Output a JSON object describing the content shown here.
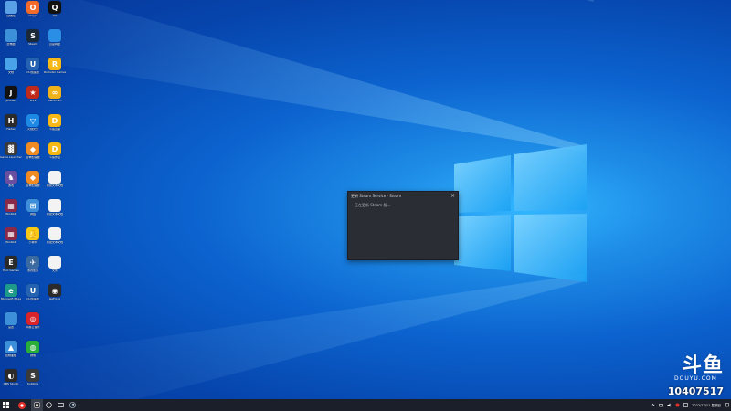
{
  "desktop_icons": [
    {
      "col": 0,
      "row": 0,
      "label": "回收站",
      "color": "#5aa0e6",
      "icon": "recycle-bin-icon",
      "glyph": ""
    },
    {
      "col": 1,
      "row": 0,
      "label": "Origin",
      "color": "#f26b2a",
      "icon": "origin-icon",
      "glyph": "O"
    },
    {
      "col": 2,
      "row": 0,
      "label": "QQ",
      "color": "#111111",
      "icon": "qq-icon",
      "glyph": "Q"
    },
    {
      "col": 0,
      "row": 1,
      "label": "此电脑",
      "color": "#3d8fd9",
      "icon": "this-pc-icon",
      "glyph": ""
    },
    {
      "col": 1,
      "row": 1,
      "label": "Steam",
      "color": "#1b2838",
      "icon": "steam-icon",
      "glyph": "S"
    },
    {
      "col": 2,
      "row": 1,
      "label": "百度网盘",
      "color": "#2a8ee6",
      "icon": "baidu-netdisk-icon",
      "glyph": ""
    },
    {
      "col": 0,
      "row": 2,
      "label": "文档",
      "color": "#4aa3e8",
      "icon": "documents-icon",
      "glyph": ""
    },
    {
      "col": 1,
      "row": 2,
      "label": "UU加速器",
      "color": "#2563b0",
      "icon": "uu-accelerator-icon",
      "glyph": "U"
    },
    {
      "col": 2,
      "row": 2,
      "label": "Rockstar Games",
      "color": "#f5b816",
      "icon": "rockstar-icon",
      "glyph": "R"
    },
    {
      "col": 0,
      "row": 3,
      "label": "Jinshan",
      "color": "#111111",
      "icon": "jinshan-icon",
      "glyph": "J"
    },
    {
      "col": 1,
      "row": 3,
      "label": "WPS",
      "color": "#c02a1a",
      "icon": "wps-icon",
      "glyph": "★"
    },
    {
      "col": 2,
      "row": 3,
      "label": "Bandicam",
      "color": "#f0b21a",
      "icon": "bandicam-icon",
      "glyph": "∞"
    },
    {
      "col": 0,
      "row": 4,
      "label": "Hades",
      "color": "#2b2b2b",
      "icon": "hades-icon",
      "glyph": "H"
    },
    {
      "col": 1,
      "row": 4,
      "label": "火绒安全",
      "color": "#1e88e5",
      "icon": "huorong-icon",
      "glyph": "▽"
    },
    {
      "col": 2,
      "row": 4,
      "label": "斗鱼直播",
      "color": "#f5b816",
      "icon": "douyu-app-icon",
      "glyph": "D"
    },
    {
      "col": 0,
      "row": 5,
      "label": "Game Launcher",
      "color": "#3b3b3b",
      "icon": "game-launcher-icon",
      "glyph": "▓"
    },
    {
      "col": 1,
      "row": 5,
      "label": "雷神加速器",
      "color": "#f08a24",
      "icon": "leishen-icon",
      "glyph": "◆"
    },
    {
      "col": 2,
      "row": 5,
      "label": "斗鱼伴侣",
      "color": "#f5b816",
      "icon": "douyu-companion-icon",
      "glyph": "D"
    },
    {
      "col": 0,
      "row": 6,
      "label": "游戏",
      "color": "#6a4fa0",
      "icon": "game-icon",
      "glyph": "♞"
    },
    {
      "col": 1,
      "row": 6,
      "label": "雷神加速器",
      "color": "#f08a24",
      "icon": "leishen-2-icon",
      "glyph": "◆"
    },
    {
      "col": 2,
      "row": 6,
      "label": "新建文本文档",
      "color": "#f3f3f3",
      "icon": "text-file-icon",
      "glyph": ""
    },
    {
      "col": 0,
      "row": 7,
      "label": "WinRAR",
      "color": "#8a2a4a",
      "icon": "winrar-icon",
      "glyph": "▦"
    },
    {
      "col": 1,
      "row": 7,
      "label": "网络",
      "color": "#3d8fd9",
      "icon": "network-icon",
      "glyph": "⊞"
    },
    {
      "col": 2,
      "row": 7,
      "label": "新建文本文档",
      "color": "#f3f3f3",
      "icon": "text-file-2-icon",
      "glyph": ""
    },
    {
      "col": 0,
      "row": 8,
      "label": "WinRAR",
      "color": "#8a2a4a",
      "icon": "winrar-2-icon",
      "glyph": "▦"
    },
    {
      "col": 1,
      "row": 8,
      "label": "小黄鸭",
      "color": "#f5c816",
      "icon": "duck-icon",
      "glyph": "🔔"
    },
    {
      "col": 2,
      "row": 8,
      "label": "新建文本文档",
      "color": "#f3f3f3",
      "icon": "text-file-3-icon",
      "glyph": ""
    },
    {
      "col": 0,
      "row": 9,
      "label": "Epic Games",
      "color": "#2a2a2a",
      "icon": "epic-games-icon",
      "glyph": "E"
    },
    {
      "col": 1,
      "row": 9,
      "label": "游戏加速",
      "color": "#3a6aa0",
      "icon": "game-boost-icon",
      "glyph": "✈"
    },
    {
      "col": 2,
      "row": 9,
      "label": "文件",
      "color": "#f3f3f3",
      "icon": "file-icon",
      "glyph": ""
    },
    {
      "col": 0,
      "row": 10,
      "label": "Microsoft Edge",
      "color": "#1e9a8a",
      "icon": "edge-icon",
      "glyph": "e"
    },
    {
      "col": 1,
      "row": 10,
      "label": "UU加速器",
      "color": "#2563b0",
      "icon": "uu-2-icon",
      "glyph": "U"
    },
    {
      "col": 2,
      "row": 10,
      "label": "GeForce",
      "color": "#2a2a2a",
      "icon": "geforce-icon",
      "glyph": "◉"
    },
    {
      "col": 0,
      "row": 11,
      "label": "设置",
      "color": "#3d8fd9",
      "icon": "settings-icon",
      "glyph": ""
    },
    {
      "col": 1,
      "row": 11,
      "label": "网易云音乐",
      "color": "#d8242a",
      "icon": "netease-music-icon",
      "glyph": "◎"
    },
    {
      "col": 0,
      "row": 12,
      "label": "控制面板",
      "color": "#3d8fd9",
      "icon": "control-panel-icon",
      "glyph": "▲"
    },
    {
      "col": 1,
      "row": 12,
      "label": "微信",
      "color": "#2aae3a",
      "icon": "wechat-icon",
      "glyph": "◍"
    },
    {
      "col": 0,
      "row": 13,
      "label": "OBS Studio",
      "color": "#2a2a2a",
      "icon": "obs-icon",
      "glyph": "◐"
    },
    {
      "col": 1,
      "row": 13,
      "label": "Sublime",
      "color": "#3a3a3a",
      "icon": "sublime-icon",
      "glyph": "S"
    }
  ],
  "steam_dialog": {
    "title": "更新 Steam Service - Steam",
    "message": "正在更新 Steam 服...",
    "close_glyph": "×"
  },
  "watermark": {
    "logo": "斗鱼",
    "sub": "DOUYU.COM",
    "room_id": "10407517"
  },
  "taskbar": {
    "buttons": [
      {
        "name": "start-button",
        "icon": "windows-logo-icon",
        "active": false
      },
      {
        "name": "taskbar-douyu",
        "icon": "record-icon",
        "active": false
      },
      {
        "name": "taskbar-app",
        "icon": "app-icon",
        "active": true
      },
      {
        "name": "taskbar-search",
        "icon": "search-icon",
        "active": false
      },
      {
        "name": "taskbar-widget",
        "icon": "widget-icon",
        "active": false
      },
      {
        "name": "taskbar-steam",
        "icon": "steam-icon",
        "active": false
      }
    ],
    "clock_time": "",
    "clock_date": "2022/12/11 星期日"
  },
  "colors": {
    "taskbar": "#1b1f29",
    "dialog": "#2a2d33"
  }
}
